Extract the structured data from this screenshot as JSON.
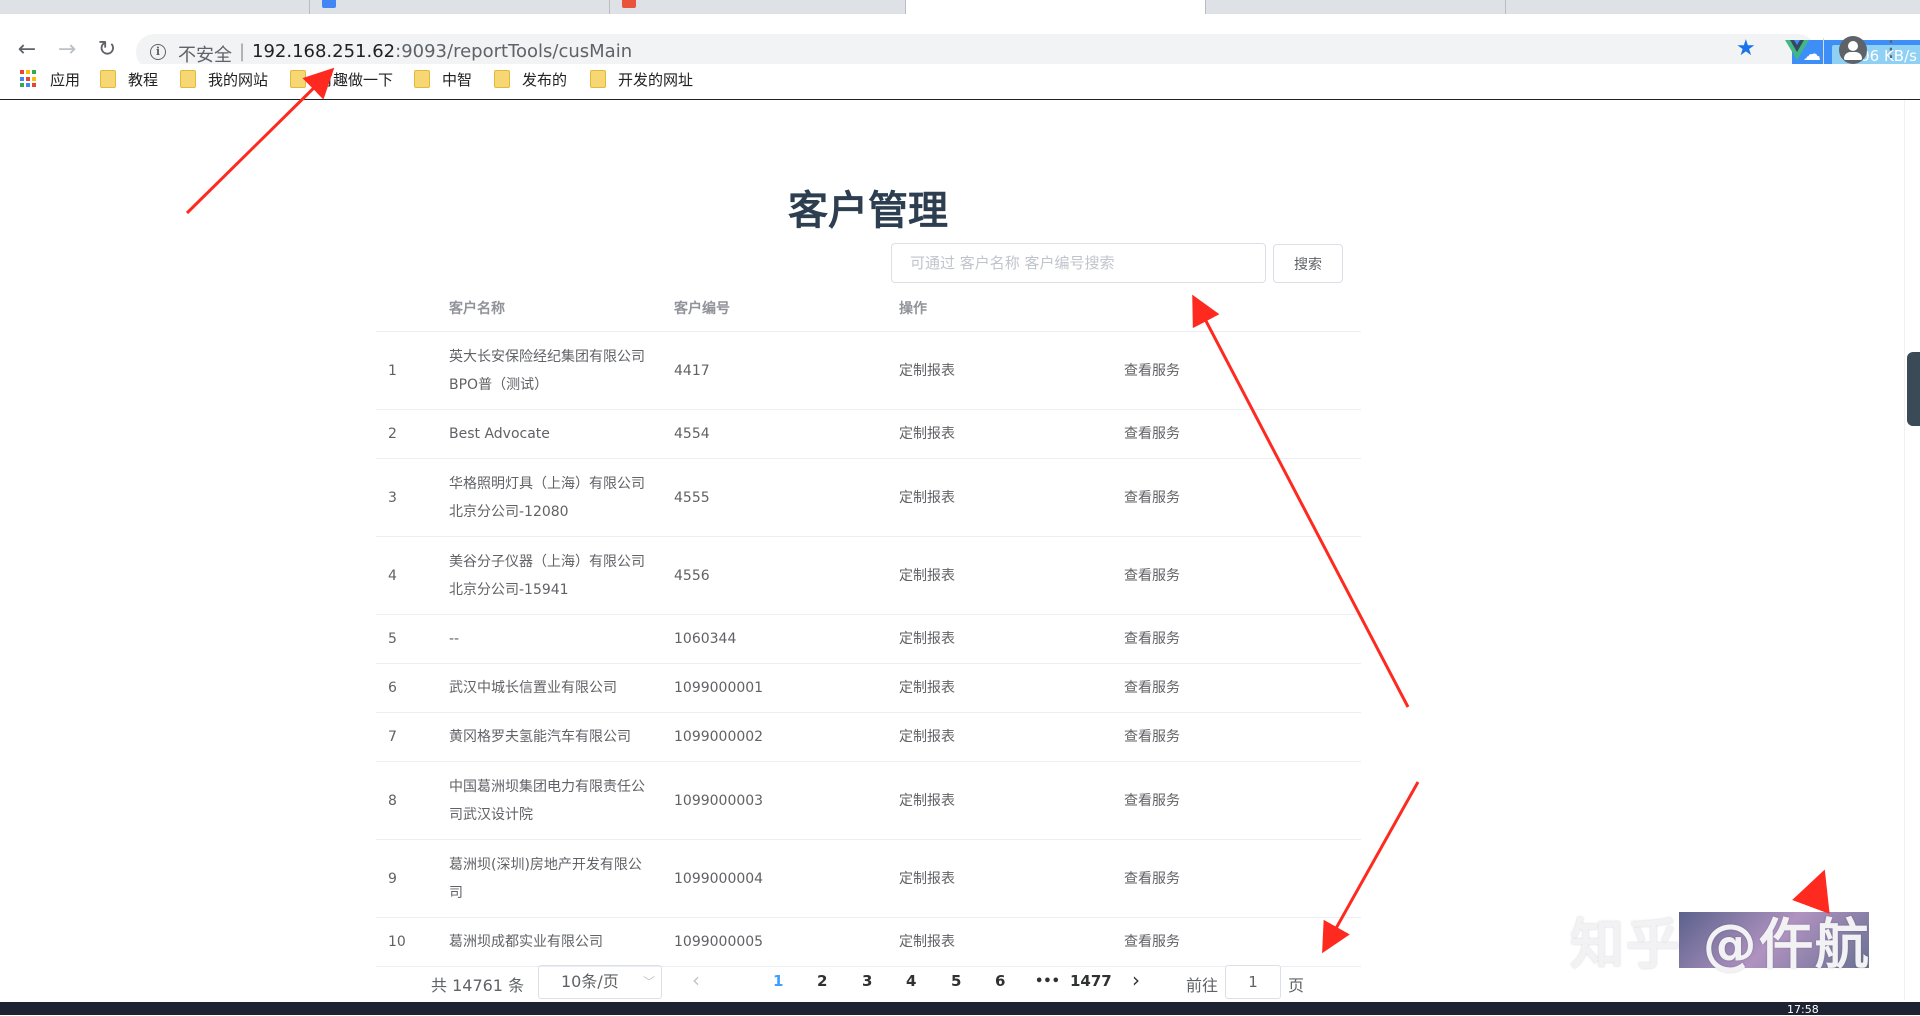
{
  "browser": {
    "insecure_label": "不安全",
    "separator": "|",
    "url_host": "192.168.251.62",
    "url_rest": ":9093/reportTools/cusMain",
    "download_speed": "↓106 KB/s"
  },
  "bookmarks": {
    "apps": "应用",
    "items": [
      "教程",
      "我的网站",
      "有趣做一下",
      "中智",
      "发布的",
      "开发的网址"
    ]
  },
  "page": {
    "title": "客户管理",
    "search_placeholder": "可通过 客户名称 客户编号搜索",
    "search_button": "搜索"
  },
  "table": {
    "headers": {
      "name": "客户名称",
      "code": "客户编号",
      "op": "操作"
    },
    "action_custom": "定制报表",
    "action_view": "查看服务",
    "rows": [
      {
        "idx": "1",
        "name": "英大长安保险经纪集团有限公司BPO普（测试）",
        "code": "4417"
      },
      {
        "idx": "2",
        "name": "Best Advocate",
        "code": "4554"
      },
      {
        "idx": "3",
        "name": "华格照明灯具（上海）有限公司北京分公司-12080",
        "code": "4555"
      },
      {
        "idx": "4",
        "name": "美谷分子仪器（上海）有限公司北京分公司-15941",
        "code": "4556"
      },
      {
        "idx": "5",
        "name": "--",
        "code": "1060344"
      },
      {
        "idx": "6",
        "name": "武汉中城长信置业有限公司",
        "code": "1099000001"
      },
      {
        "idx": "7",
        "name": "黄冈格罗夫氢能汽车有限公司",
        "code": "1099000002"
      },
      {
        "idx": "8",
        "name": "中国葛洲坝集团电力有限责任公司武汉设计院",
        "code": "1099000003"
      },
      {
        "idx": "9",
        "name": "葛洲坝(深圳)房地产开发有限公司",
        "code": "1099000004"
      },
      {
        "idx": "10",
        "name": "葛洲坝成都实业有限公司",
        "code": "1099000005"
      }
    ]
  },
  "pagination": {
    "total": "共 14761 条",
    "page_size": "10条/页",
    "pages": [
      "1",
      "2",
      "3",
      "4",
      "5",
      "6",
      "•••",
      "1477"
    ],
    "current": "1",
    "goto_label": "前往",
    "goto_value": "1",
    "goto_unit": "页"
  },
  "watermark": "知乎 @仵航",
  "clock": "17:58",
  "colors": {
    "accent": "#409eff",
    "arrow": "#ff2a1f",
    "title": "#2c3e50"
  }
}
